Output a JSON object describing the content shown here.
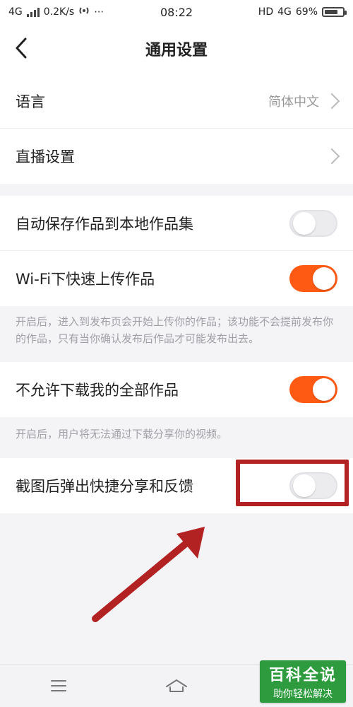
{
  "status_bar": {
    "network": "4G",
    "speed": "0.2K/s",
    "time": "08:22",
    "hd": "HD",
    "lte": "4G",
    "battery": "69%"
  },
  "header": {
    "title": "通用设置"
  },
  "section1": {
    "language_label": "语言",
    "language_value": "简体中文",
    "live_label": "直播设置"
  },
  "section2": {
    "autosave_label": "自动保存作品到本地作品集",
    "wifi_upload_label": "Wi-Fi下快速上传作品",
    "wifi_note": "开启后，进入到发布页会开始上传你的作品；该功能不会提前发布你的作品，只有当你确认发布后作品才可能发布出去。"
  },
  "section3": {
    "disallow_download_label": "不允许下载我的全部作品",
    "disallow_note": "开启后，用户将无法通过下载分享你的视频。"
  },
  "section4": {
    "screenshot_share_label": "截图后弹出快捷分享和反馈"
  },
  "watermark": {
    "title": "百科全说",
    "subtitle": "助你轻松解决"
  },
  "colors": {
    "accent": "#ff5a14",
    "highlight": "#b22222",
    "watermark_bg": "#2d9b3e"
  },
  "icons": {
    "back": "chevron-left-icon",
    "menu": "menu-icon",
    "home": "home-icon"
  },
  "toggles": {
    "autosave": false,
    "wifi_upload": true,
    "disallow_download": true,
    "screenshot_share": false
  }
}
